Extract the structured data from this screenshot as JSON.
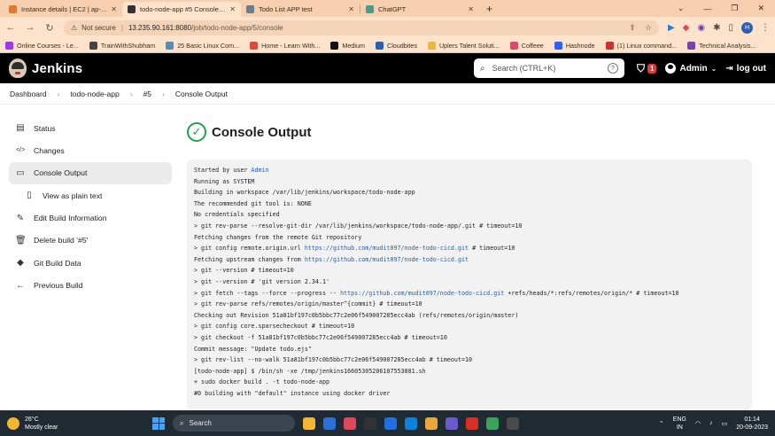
{
  "browser": {
    "tabs": [
      {
        "title": "Instance details | EC2 | ap-south",
        "favicon_color": "#e07a2e",
        "active": false
      },
      {
        "title": "todo-node-app #5 Console [Jenk",
        "favicon_color": "#333333",
        "active": true
      },
      {
        "title": "Todo List APP test",
        "favicon_color": "#6a7b8c",
        "active": false
      },
      {
        "title": "ChatGPT",
        "favicon_color": "#4a9c87",
        "active": false
      }
    ],
    "new_tab_label": "+",
    "address": {
      "security_label": "Not secure",
      "host": "13.235.90.161:8080",
      "path": "/job/todo-node-app/5/console"
    },
    "profile_initial": "H",
    "bookmarks": [
      {
        "label": "Online Courses - Le...",
        "color": "#a435f0"
      },
      {
        "label": "TrainWithShubham",
        "color": "#444444"
      },
      {
        "label": "25 Basic Linux Com...",
        "color": "#4a90c0"
      },
      {
        "label": "Home - Learn With...",
        "color": "#e04a3a"
      },
      {
        "label": "Medium",
        "color": "#111111"
      },
      {
        "label": "Cloudbites",
        "color": "#2b5fb0"
      },
      {
        "label": "Uplers Talent Soluti...",
        "color": "#f2b632"
      },
      {
        "label": "Coffeee",
        "color": "#e0486a"
      },
      {
        "label": "Hashnode",
        "color": "#2962ff"
      },
      {
        "label": "(1) Linux command...",
        "color": "#d03030"
      },
      {
        "label": "Technical Analysis...",
        "color": "#7a3fb0"
      }
    ]
  },
  "jenkins": {
    "title": "Jenkins",
    "search_placeholder": "Search (CTRL+K)",
    "help_glyph": "?",
    "alert_count": "1",
    "user": "Admin",
    "logout_label": "log out"
  },
  "breadcrumb": [
    "Dashboard",
    "todo-node-app",
    "#5",
    "Console Output"
  ],
  "sidebar": [
    {
      "label": "Status",
      "icon": "document-icon"
    },
    {
      "label": "Changes",
      "icon": "code-icon"
    },
    {
      "label": "Console Output",
      "icon": "terminal-icon",
      "active": true
    },
    {
      "label": "View as plain text",
      "icon": "page-icon",
      "sub": true
    },
    {
      "label": "Edit Build Information",
      "icon": "edit-icon"
    },
    {
      "label": "Delete build '#5'",
      "icon": "trash-icon"
    },
    {
      "label": "Git Build Data",
      "icon": "git-icon"
    },
    {
      "label": "Previous Build",
      "icon": "arrow-left-icon"
    }
  ],
  "page_title": "Console Output",
  "console_lines": [
    {
      "parts": [
        {
          "t": "Started by user "
        },
        {
          "t": "Admin",
          "link": true
        }
      ]
    },
    {
      "parts": [
        {
          "t": "Running as SYSTEM"
        }
      ]
    },
    {
      "parts": [
        {
          "t": "Building in workspace /var/lib/jenkins/workspace/todo-node-app"
        }
      ]
    },
    {
      "parts": [
        {
          "t": "The recommended git tool is: NONE"
        }
      ]
    },
    {
      "parts": [
        {
          "t": "No credentials specified"
        }
      ]
    },
    {
      "parts": [
        {
          "t": " > git rev-parse --resolve-git-dir /var/lib/jenkins/workspace/todo-node-app/.git # timeout=10"
        }
      ]
    },
    {
      "parts": [
        {
          "t": "Fetching changes from the remote Git repository"
        }
      ]
    },
    {
      "parts": [
        {
          "t": " > git config remote.origin.url "
        },
        {
          "t": "https://github.com/mudit097/node-todo-cicd.git",
          "link": true
        },
        {
          "t": " # timeout=10"
        }
      ]
    },
    {
      "parts": [
        {
          "t": "Fetching upstream changes from "
        },
        {
          "t": "https://github.com/mudit097/node-todo-cicd.git",
          "link": true
        }
      ]
    },
    {
      "parts": [
        {
          "t": " > git --version # timeout=10"
        }
      ]
    },
    {
      "parts": [
        {
          "t": " > git --version # 'git version 2.34.1'"
        }
      ]
    },
    {
      "parts": [
        {
          "t": " > git fetch --tags --force --progress -- "
        },
        {
          "t": "https://github.com/mudit097/node-todo-cicd.git",
          "link": true
        },
        {
          "t": " +refs/heads/*:refs/remotes/origin/* # timeout=10"
        }
      ]
    },
    {
      "parts": [
        {
          "t": " > git rev-parse refs/remotes/origin/master^{commit} # timeout=10"
        }
      ]
    },
    {
      "parts": [
        {
          "t": "Checking out Revision 51a81bf197c0b5bbc77c2e06f549007285ecc4ab (refs/remotes/origin/master)"
        }
      ]
    },
    {
      "parts": [
        {
          "t": " > git config core.sparsecheckout # timeout=10"
        }
      ]
    },
    {
      "parts": [
        {
          "t": " > git checkout -f 51a81bf197c0b5bbc77c2e06f549007285ecc4ab # timeout=10"
        }
      ]
    },
    {
      "parts": [
        {
          "t": "Commit message: \"Update todo.ejs\""
        }
      ]
    },
    {
      "parts": [
        {
          "t": " > git rev-list --no-walk 51a81bf197c0b5bbc77c2e06f549007285ecc4ab # timeout=10"
        }
      ]
    },
    {
      "parts": [
        {
          "t": "[todo-node-app] $ /bin/sh -xe /tmp/jenkins16605305206107553881.sh"
        }
      ]
    },
    {
      "parts": [
        {
          "t": "+ sudo docker build . -t todo-node-app"
        }
      ]
    },
    {
      "parts": [
        {
          "t": "#0 building with \"default\" instance using docker driver"
        }
      ]
    }
  ],
  "taskbar": {
    "temperature": "26°C",
    "weather": "Mostly clear",
    "search_label": "Search",
    "lang1": "ENG",
    "lang2": "IN",
    "time": "01:14",
    "date": "20-09-2023",
    "apps": [
      "#f2b632",
      "#2c6fd6",
      "#e0485a",
      "#333333",
      "#1f6fe0",
      "#0a84d8",
      "#e8a93a",
      "#6a5acd",
      "#d93025",
      "#3aa35a",
      "#4a4a4a"
    ]
  }
}
